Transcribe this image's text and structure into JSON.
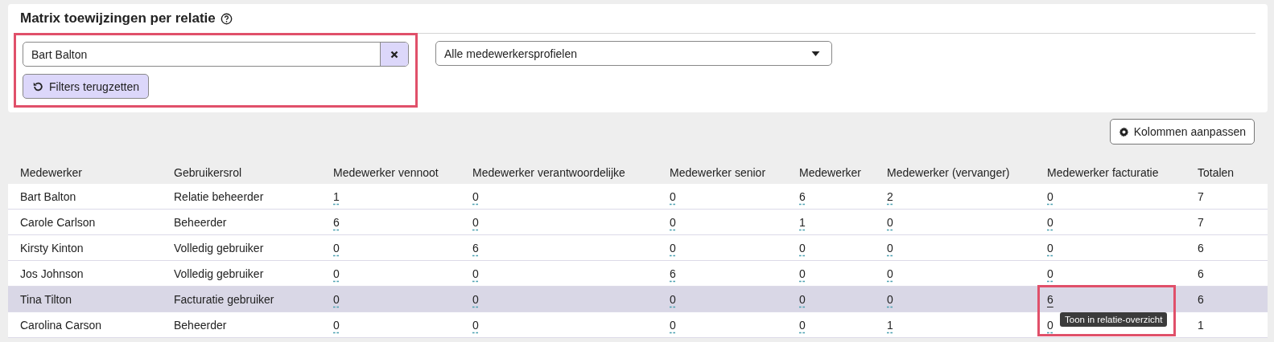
{
  "title": "Matrix toewijzingen per relatie",
  "filters": {
    "highlighted": true,
    "search": {
      "value": "Bart Balton"
    },
    "reset_button": "Filters terugzetten",
    "profile_select": {
      "value": "Alle medewerkersprofielen"
    }
  },
  "columns_button": "Kolommen aanpassen",
  "table": {
    "columns": [
      "Medewerker",
      "Gebruikersrol",
      "Medewerker vennoot",
      "Medewerker verantwoordelijke",
      "Medewerker senior",
      "Medewerker",
      "Medewerker (vervanger)",
      "Medewerker facturatie",
      "Totalen"
    ],
    "rows": [
      {
        "name": "Bart Balton",
        "role": "Relatie beheerder",
        "highlighted": false,
        "counts": [
          {
            "value": "1",
            "hovered": false
          },
          {
            "value": "0",
            "hovered": false
          },
          {
            "value": "0",
            "hovered": false
          },
          {
            "value": "6",
            "hovered": false
          },
          {
            "value": "2",
            "hovered": false
          },
          {
            "value": "0",
            "hovered": false
          }
        ],
        "total": "7"
      },
      {
        "name": "Carole Carlson",
        "role": "Beheerder",
        "highlighted": false,
        "counts": [
          {
            "value": "6",
            "hovered": false
          },
          {
            "value": "0",
            "hovered": false
          },
          {
            "value": "0",
            "hovered": false
          },
          {
            "value": "1",
            "hovered": false
          },
          {
            "value": "0",
            "hovered": false
          },
          {
            "value": "0",
            "hovered": false
          }
        ],
        "total": "7"
      },
      {
        "name": "Kirsty Kinton",
        "role": "Volledig gebruiker",
        "highlighted": false,
        "counts": [
          {
            "value": "0",
            "hovered": false
          },
          {
            "value": "6",
            "hovered": false
          },
          {
            "value": "0",
            "hovered": false
          },
          {
            "value": "0",
            "hovered": false
          },
          {
            "value": "0",
            "hovered": false
          },
          {
            "value": "0",
            "hovered": false
          }
        ],
        "total": "6"
      },
      {
        "name": "Jos Johnson",
        "role": "Volledig gebruiker",
        "highlighted": false,
        "counts": [
          {
            "value": "0",
            "hovered": false
          },
          {
            "value": "0",
            "hovered": false
          },
          {
            "value": "6",
            "hovered": false
          },
          {
            "value": "0",
            "hovered": false
          },
          {
            "value": "0",
            "hovered": false
          },
          {
            "value": "0",
            "hovered": false
          }
        ],
        "total": "6"
      },
      {
        "name": "Tina Tilton",
        "role": "Facturatie gebruiker",
        "highlighted": true,
        "counts": [
          {
            "value": "0",
            "hovered": false
          },
          {
            "value": "0",
            "hovered": false
          },
          {
            "value": "0",
            "hovered": false
          },
          {
            "value": "0",
            "hovered": false
          },
          {
            "value": "0",
            "hovered": false
          },
          {
            "value": "6",
            "hovered": true,
            "tooltip": "Toon in relatie-overzicht"
          }
        ],
        "total": "6"
      },
      {
        "name": "Carolina Carson",
        "role": "Beheerder",
        "highlighted": false,
        "counts": [
          {
            "value": "0",
            "hovered": false
          },
          {
            "value": "0",
            "hovered": false
          },
          {
            "value": "0",
            "hovered": false
          },
          {
            "value": "0",
            "hovered": false
          },
          {
            "value": "1",
            "hovered": false
          },
          {
            "value": "0",
            "hovered": false
          }
        ],
        "total": "1"
      }
    ]
  }
}
